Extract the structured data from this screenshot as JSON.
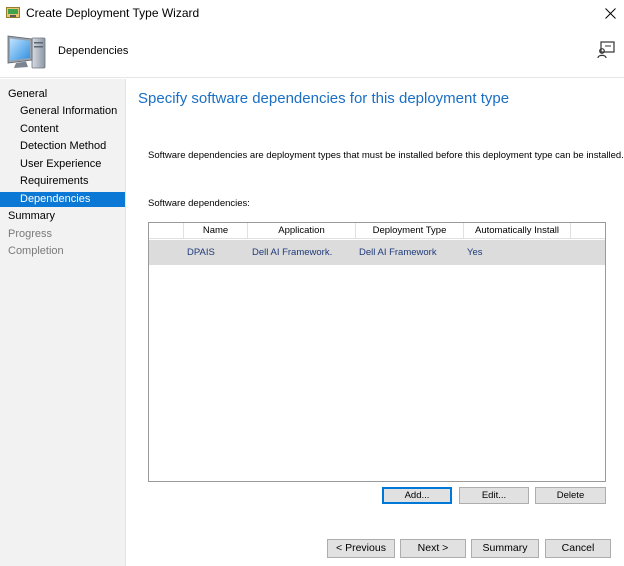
{
  "window": {
    "title": "Create Deployment Type Wizard",
    "close_glyph": "✕"
  },
  "header": {
    "title": "Dependencies",
    "icons": {
      "left": "monitor-icon",
      "right": "feedback-icon"
    }
  },
  "sidebar": {
    "items": [
      {
        "label": "General",
        "level": 1,
        "state": "normal"
      },
      {
        "label": "General Information",
        "level": 2,
        "state": "normal"
      },
      {
        "label": "Content",
        "level": 2,
        "state": "normal"
      },
      {
        "label": "Detection Method",
        "level": 2,
        "state": "normal"
      },
      {
        "label": "User Experience",
        "level": 2,
        "state": "normal"
      },
      {
        "label": "Requirements",
        "level": 2,
        "state": "normal"
      },
      {
        "label": "Dependencies",
        "level": 2,
        "state": "active"
      },
      {
        "label": "Summary",
        "level": 1,
        "state": "normal"
      },
      {
        "label": "Progress",
        "level": 1,
        "state": "disabled"
      },
      {
        "label": "Completion",
        "level": 1,
        "state": "disabled"
      }
    ]
  },
  "main": {
    "heading": "Specify software dependencies for this deployment type",
    "description": "Software dependencies are deployment types that must be installed before this deployment type can be installed.",
    "list_label": "Software dependencies:",
    "table": {
      "columns": [
        "Name",
        "Application",
        "Deployment Type",
        "Automatically Install"
      ],
      "rows": [
        [
          "DPAIS",
          "Dell AI Framework.",
          "Dell AI Framework",
          "Yes"
        ]
      ]
    },
    "buttons": {
      "add": "Add...",
      "edit": "Edit...",
      "delete": "Delete"
    }
  },
  "footer": {
    "previous": "< Previous",
    "next": "Next >",
    "summary": "Summary",
    "cancel": "Cancel"
  },
  "colors": {
    "accent": "#0a78d4",
    "heading": "#1a6fc4",
    "sidebar_bg": "#f2f2f2",
    "selected_row": "#dcdcdc"
  }
}
